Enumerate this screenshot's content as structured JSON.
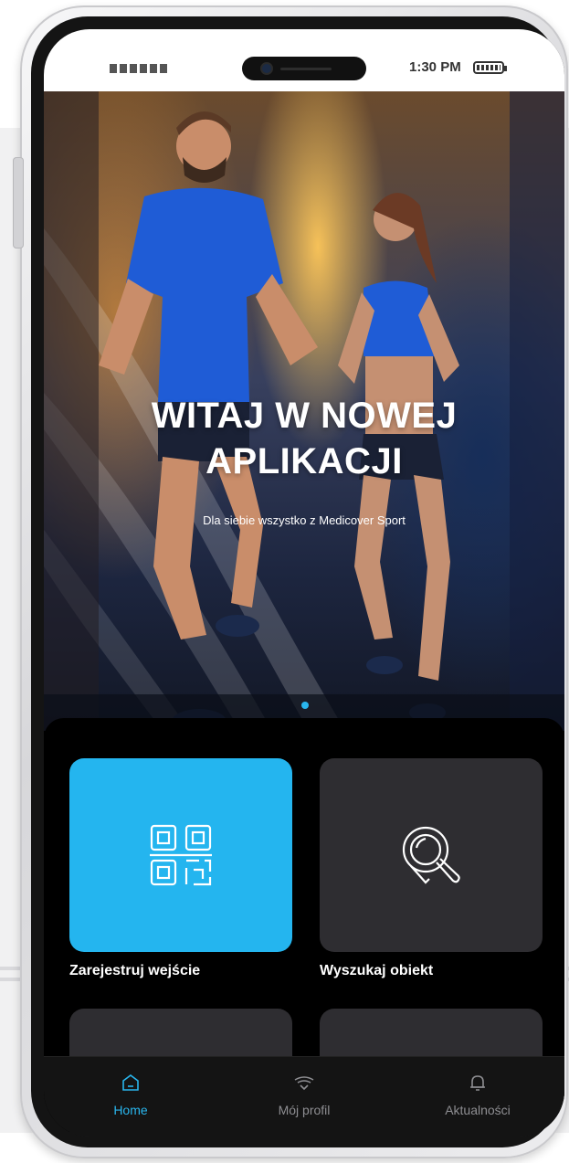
{
  "status_bar": {
    "time": "1:30 PM"
  },
  "hero": {
    "title_line1": "WITAJ W NOWEJ",
    "title_line2": "APLIKACJI",
    "subtitle": "Dla siebie wszystko z Medicover Sport",
    "active_slide": 1
  },
  "tiles": [
    {
      "label": "Zarejestruj wejście",
      "icon": "qr-code-icon",
      "color": "#24b5ef"
    },
    {
      "label": "Wyszukaj obiekt",
      "icon": "search-location-icon",
      "color": "#2e2d31"
    },
    {
      "label": "",
      "icon": "",
      "color": "#2e2d31"
    },
    {
      "label": "",
      "icon": "",
      "color": "#2e2d31"
    }
  ],
  "bottom_nav": {
    "items": [
      {
        "label": "Home",
        "icon": "home-icon",
        "active": true
      },
      {
        "label": "Mój profil",
        "icon": "profile-icon",
        "active": false
      },
      {
        "label": "Aktualności",
        "icon": "bell-icon",
        "active": false
      }
    ]
  },
  "colors": {
    "accent": "#29b6ee",
    "tile_dark": "#2e2d31",
    "sheet": "#000000",
    "nav_bg": "#141414"
  }
}
